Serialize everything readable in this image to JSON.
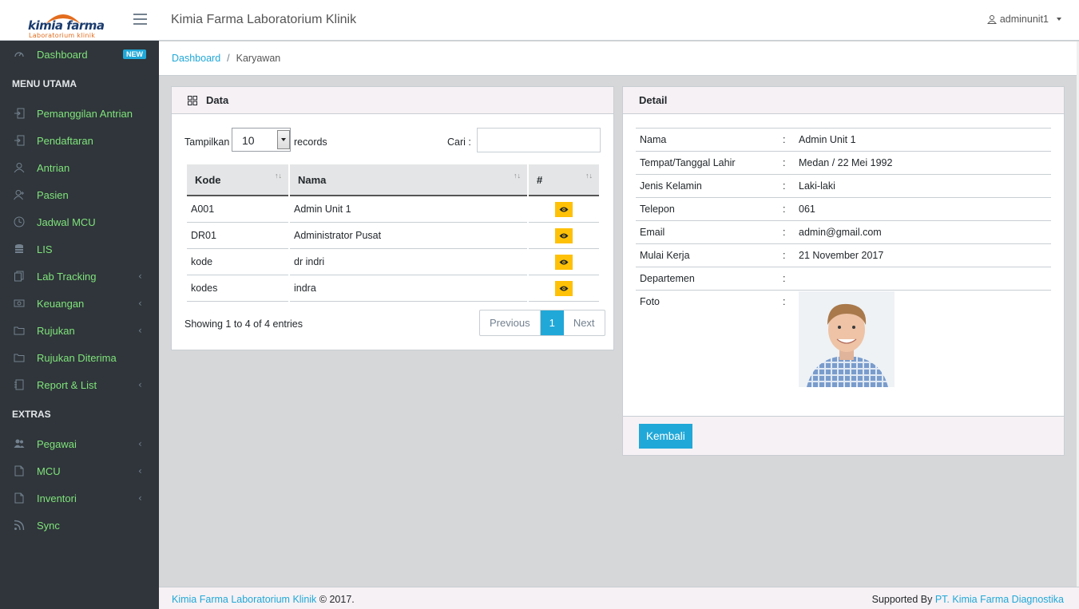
{
  "brand": {
    "logo_main": "kimia farma",
    "logo_sub": "Laboratorium klinik"
  },
  "header": {
    "app_title": "Kimia Farma Laboratorium Klinik",
    "user": "adminunit1"
  },
  "sidebar": {
    "dashboard": {
      "label": "Dashboard",
      "badge": "NEW"
    },
    "section_main": "MENU UTAMA",
    "main_items": [
      {
        "label": "Pemanggilan Antrian",
        "icon": "login-icon",
        "submenu": false
      },
      {
        "label": "Pendaftaran",
        "icon": "login-icon",
        "submenu": false
      },
      {
        "label": "Antrian",
        "icon": "user-icon",
        "submenu": false
      },
      {
        "label": "Pasien",
        "icon": "user-follow-icon",
        "submenu": false
      },
      {
        "label": "Jadwal MCU",
        "icon": "clock-icon",
        "submenu": false
      },
      {
        "label": "LIS",
        "icon": "database-icon",
        "submenu": false
      },
      {
        "label": "Lab Tracking",
        "icon": "docs-icon",
        "submenu": true
      },
      {
        "label": "Keuangan",
        "icon": "money-icon",
        "submenu": true
      },
      {
        "label": "Rujukan",
        "icon": "folder-icon",
        "submenu": true
      },
      {
        "label": "Rujukan Diterima",
        "icon": "folder-icon",
        "submenu": false
      },
      {
        "label": "Report & List",
        "icon": "notebook-icon",
        "submenu": true
      }
    ],
    "section_extras": "EXTRAS",
    "extra_items": [
      {
        "label": "Pegawai",
        "icon": "people-icon",
        "submenu": true
      },
      {
        "label": "MCU",
        "icon": "doc-icon",
        "submenu": true
      },
      {
        "label": "Inventori",
        "icon": "doc-icon",
        "submenu": true
      },
      {
        "label": "Sync",
        "icon": "rss-icon",
        "submenu": false
      }
    ]
  },
  "breadcrumb": {
    "home": "Dashboard",
    "current": "Karyawan",
    "separator": "/"
  },
  "data_card": {
    "title": "Data",
    "show_label": "Tampilkan",
    "page_size": "10",
    "records_label": "records",
    "search_label": "Cari :",
    "search_value": "",
    "columns": [
      "Kode",
      "Nama",
      "#"
    ],
    "rows": [
      {
        "kode": "A001",
        "nama": "Admin Unit 1"
      },
      {
        "kode": "DR01",
        "nama": "Administrator Pusat"
      },
      {
        "kode": "kode",
        "nama": "dr indri"
      },
      {
        "kode": "kodes",
        "nama": "indra"
      }
    ],
    "showing": "Showing 1 to 4 of 4 entries",
    "pager": {
      "prev": "Previous",
      "current": "1",
      "next": "Next"
    }
  },
  "detail_card": {
    "title": "Detail",
    "fields": [
      {
        "key": "Nama",
        "value": "Admin Unit 1"
      },
      {
        "key": "Tempat/Tanggal Lahir",
        "value": "Medan / 22 Mei 1992"
      },
      {
        "key": "Jenis Kelamin",
        "value": "Laki-laki"
      },
      {
        "key": "Telepon",
        "value": "061"
      },
      {
        "key": "Email",
        "value": "admin@gmail.com"
      },
      {
        "key": "Mulai Kerja",
        "value": "21 November 2017"
      },
      {
        "key": "Departemen",
        "value": ""
      },
      {
        "key": "Foto",
        "value": ""
      }
    ],
    "colon": ":",
    "back_label": "Kembali"
  },
  "footer": {
    "left_link": "Kimia Farma Laboratorium Klinik",
    "left_text": " © 2017.",
    "right_text": "Supported By ",
    "right_link": "PT. Kimia Farma Diagnostika"
  },
  "colors": {
    "accent": "#20a8d8",
    "sidebar": "#2f353a",
    "nav_text": "#7fe37b",
    "warning": "#ffc107"
  }
}
